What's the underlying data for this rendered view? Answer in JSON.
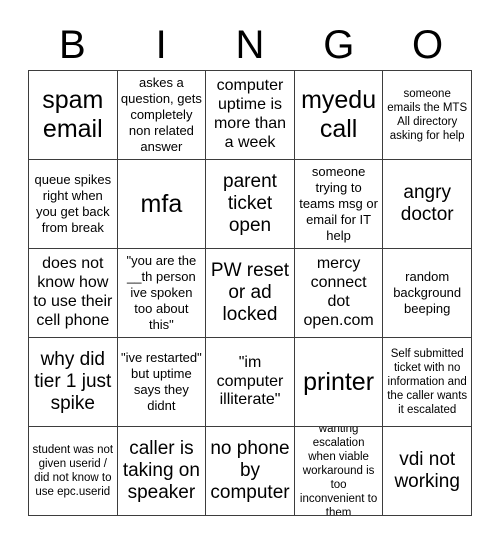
{
  "card": {
    "header_letters": [
      "B",
      "I",
      "N",
      "G",
      "O"
    ],
    "grid": {
      "columns": 5,
      "rows": 5
    },
    "cells": [
      {
        "text": "spam email",
        "size": "xl"
      },
      {
        "text": "askes a question, gets completely non related answer",
        "size": "sm"
      },
      {
        "text": "computer uptime is more than a week",
        "size": "md"
      },
      {
        "text": "myedu call",
        "size": "xl"
      },
      {
        "text": "someone emails the MTS All directory asking for help",
        "size": "xs"
      },
      {
        "text": "queue spikes right when you get back from break",
        "size": "sm"
      },
      {
        "text": "mfa",
        "size": "xl"
      },
      {
        "text": "parent ticket open",
        "size": "lg"
      },
      {
        "text": "someone trying to teams msg or email for IT help",
        "size": "sm"
      },
      {
        "text": "angry doctor",
        "size": "lg"
      },
      {
        "text": "does not know how to use their cell phone",
        "size": "md"
      },
      {
        "text": "\"you are the __th person ive spoken too about this\"",
        "size": "sm"
      },
      {
        "text": "PW reset or ad locked",
        "size": "lg"
      },
      {
        "text": "mercy connect dot open.com",
        "size": "md"
      },
      {
        "text": "random background beeping",
        "size": "sm"
      },
      {
        "text": "why did tier 1 just spike",
        "size": "lg"
      },
      {
        "text": "\"ive restarted\" but uptime says they didnt",
        "size": "sm"
      },
      {
        "text": "\"im computer illiterate\"",
        "size": "md"
      },
      {
        "text": "printer",
        "size": "xl"
      },
      {
        "text": "Self submitted ticket with no information and the caller wants it escalated",
        "size": "xs"
      },
      {
        "text": "student was not given userid / did not know to use epc.userid",
        "size": "xs"
      },
      {
        "text": "caller is taking on speaker",
        "size": "lg"
      },
      {
        "text": "no phone by computer",
        "size": "lg"
      },
      {
        "text": "wanting escalation when viable workaround is too inconvenient to them",
        "size": "xs"
      },
      {
        "text": "vdi not working",
        "size": "lg"
      }
    ]
  },
  "colors": {
    "background": "#ffffff",
    "text": "#000000",
    "grid_line": "#3d3d3d"
  }
}
